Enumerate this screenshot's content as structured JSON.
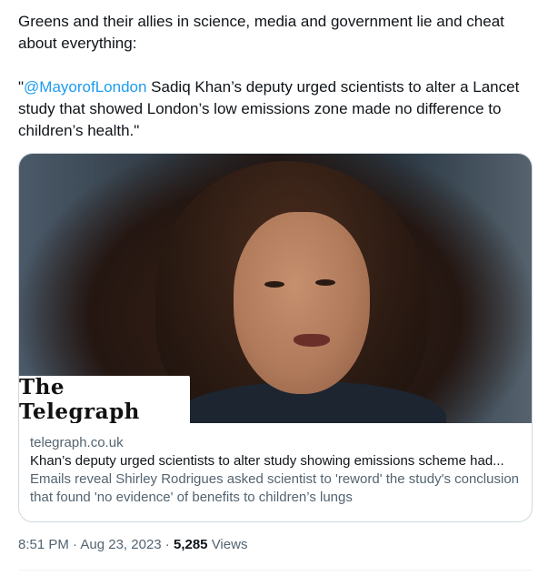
{
  "tweet": {
    "text_line1": "Greens and their allies in science, media and government lie and cheat about everything:",
    "quote_open": "\"",
    "mention": "@MayorofLondon",
    "quote_rest": " Sadiq Khan’s deputy urged scientists to alter a Lancet study that showed London’s low emissions zone made no difference to children’s health.\""
  },
  "card": {
    "logo": "The Telegraph",
    "domain": "telegraph.co.uk",
    "title": "Khan’s deputy urged scientists to alter study showing emissions scheme had...",
    "description": "Emails reveal Shirley Rodrigues asked scientist to 'reword' the study's conclusion that found 'no evidence' of benefits to children’s lungs"
  },
  "meta": {
    "time": "8:51 PM",
    "separator": " · ",
    "date": "Aug 23, 2023",
    "views_count": "5,285",
    "views_label": "Views"
  },
  "colors": {
    "link": "#1d9bf0",
    "text": "#0f1419",
    "secondary": "#536471",
    "border": "#cfd9de"
  }
}
